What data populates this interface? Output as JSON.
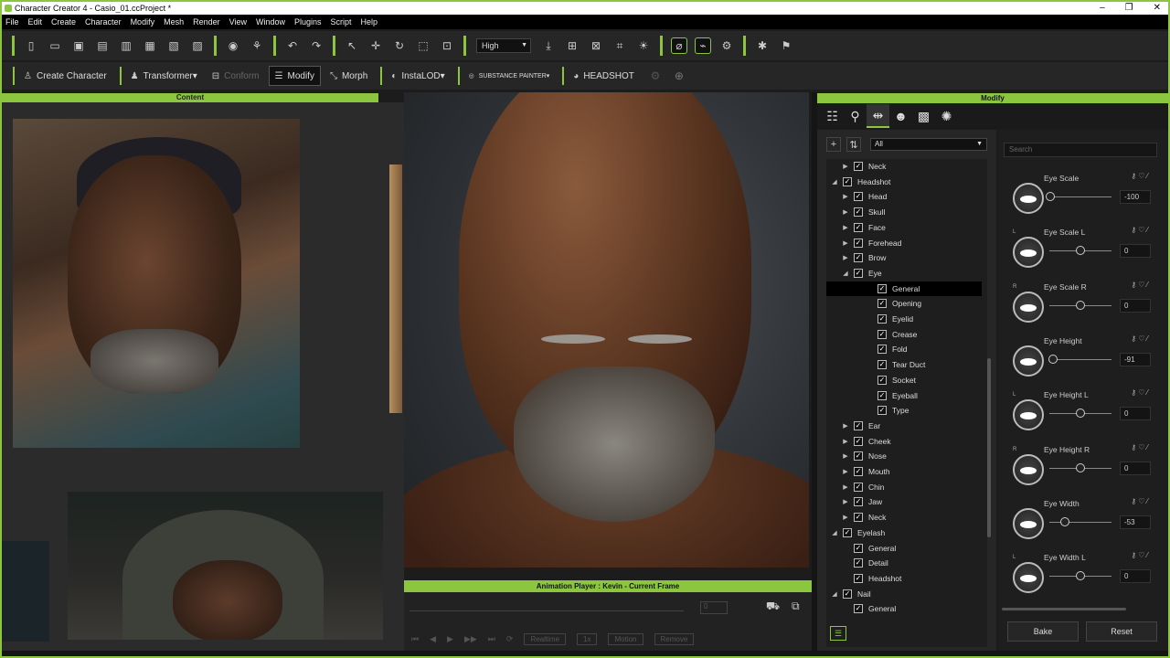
{
  "title": "Character Creator 4 - Casio_01.ccProject *",
  "window_controls": [
    "–",
    "❐",
    "✕"
  ],
  "menu": [
    "File",
    "Edit",
    "Create",
    "Character",
    "Modify",
    "Mesh",
    "Render",
    "View",
    "Window",
    "Plugins",
    "Script",
    "Help"
  ],
  "toolbar": {
    "quality": "High"
  },
  "toolbar2": {
    "create_character": "Create Character",
    "transformer": "Transformer",
    "conform": "Conform",
    "modify": "Modify",
    "morph": "Morph",
    "instalod": "InstaLOD",
    "substance": "SUBSTANCE PAINTER",
    "headshot": "HEADSHOT"
  },
  "content_panel": {
    "title": "Content"
  },
  "animation_player": {
    "title": "Animation Player : Kevin - Current Frame",
    "frame": "0",
    "realtime": "Realtime",
    "speed": "1x",
    "motion": "Motion",
    "remove": "Remove"
  },
  "modify_panel": {
    "title": "Modify",
    "filter": "All",
    "search_placeholder": "Search",
    "tree": [
      {
        "label": "Neck",
        "level": 2,
        "arrow": "▶"
      },
      {
        "label": "Headshot",
        "level": 1,
        "arrow": "◢"
      },
      {
        "label": "Head",
        "level": 2,
        "arrow": "▶"
      },
      {
        "label": "Skull",
        "level": 2,
        "arrow": "▶"
      },
      {
        "label": "Face",
        "level": 2,
        "arrow": "▶"
      },
      {
        "label": "Forehead",
        "level": 2,
        "arrow": "▶"
      },
      {
        "label": "Brow",
        "level": 2,
        "arrow": "▶"
      },
      {
        "label": "Eye",
        "level": 2,
        "arrow": "◢"
      },
      {
        "label": "General",
        "level": 3,
        "arrow": "",
        "selected": true
      },
      {
        "label": "Opening",
        "level": 3,
        "arrow": ""
      },
      {
        "label": "Eyelid",
        "level": 3,
        "arrow": ""
      },
      {
        "label": "Crease",
        "level": 3,
        "arrow": ""
      },
      {
        "label": "Fold",
        "level": 3,
        "arrow": ""
      },
      {
        "label": "Tear Duct",
        "level": 3,
        "arrow": ""
      },
      {
        "label": "Socket",
        "level": 3,
        "arrow": ""
      },
      {
        "label": "Eyeball",
        "level": 3,
        "arrow": ""
      },
      {
        "label": "Type",
        "level": 3,
        "arrow": ""
      },
      {
        "label": "Ear",
        "level": 2,
        "arrow": "▶"
      },
      {
        "label": "Cheek",
        "level": 2,
        "arrow": "▶"
      },
      {
        "label": "Nose",
        "level": 2,
        "arrow": "▶"
      },
      {
        "label": "Mouth",
        "level": 2,
        "arrow": "▶"
      },
      {
        "label": "Chin",
        "level": 2,
        "arrow": "▶"
      },
      {
        "label": "Jaw",
        "level": 2,
        "arrow": "▶"
      },
      {
        "label": "Neck",
        "level": 2,
        "arrow": "▶"
      },
      {
        "label": "Eyelash",
        "level": 1,
        "arrow": "◢"
      },
      {
        "label": "General",
        "level": 2,
        "arrow": ""
      },
      {
        "label": "Detail",
        "level": 2,
        "arrow": ""
      },
      {
        "label": "Headshot",
        "level": 2,
        "arrow": ""
      },
      {
        "label": "Nail",
        "level": 1,
        "arrow": "◢"
      },
      {
        "label": "General",
        "level": 2,
        "arrow": ""
      }
    ],
    "sliders": [
      {
        "label": "Eye Scale",
        "value": "-100",
        "side": "",
        "pos": 0.0
      },
      {
        "label": "Eye Scale L",
        "value": "0",
        "side": "L",
        "pos": 0.5
      },
      {
        "label": "Eye Scale R",
        "value": "0",
        "side": "R",
        "pos": 0.5
      },
      {
        "label": "Eye Height",
        "value": "-91",
        "side": "",
        "pos": 0.05
      },
      {
        "label": "Eye Height L",
        "value": "0",
        "side": "L",
        "pos": 0.5
      },
      {
        "label": "Eye Height R",
        "value": "0",
        "side": "R",
        "pos": 0.5
      },
      {
        "label": "Eye Width",
        "value": "-53",
        "side": "",
        "pos": 0.24
      },
      {
        "label": "Eye Width L",
        "value": "0",
        "side": "L",
        "pos": 0.5
      }
    ],
    "bake": "Bake",
    "reset": "Reset"
  }
}
